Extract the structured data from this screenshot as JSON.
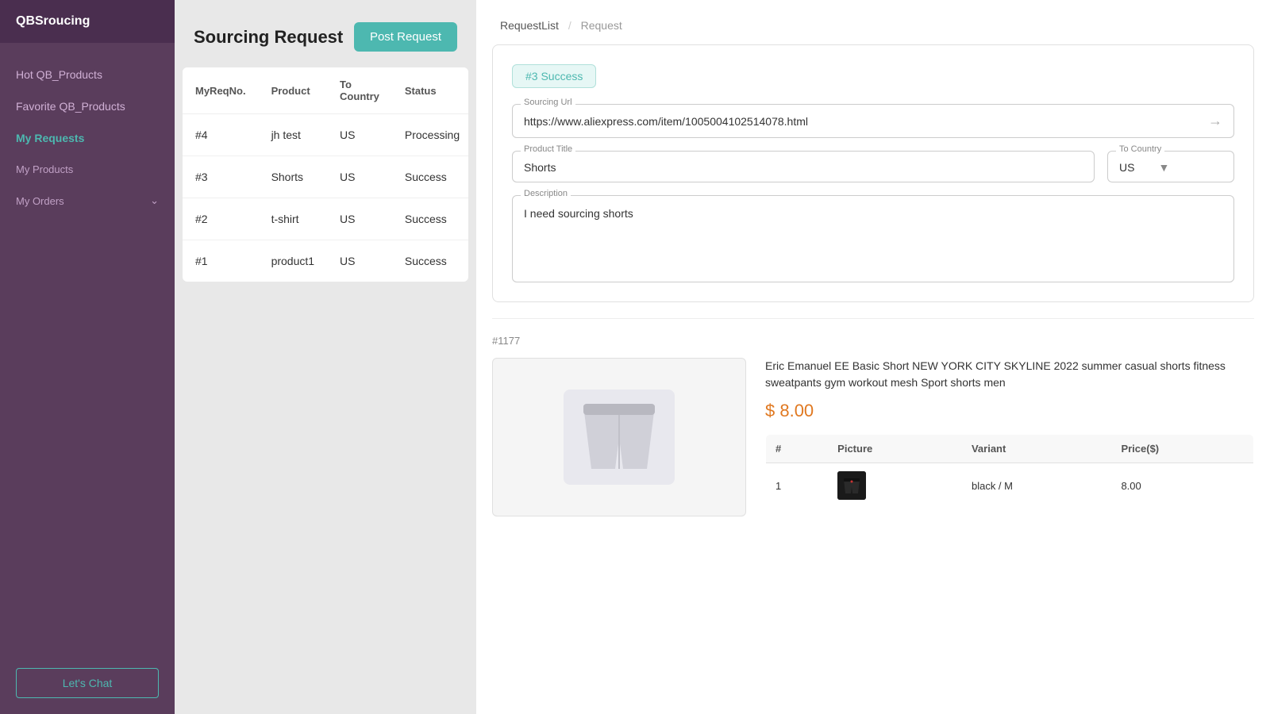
{
  "app": {
    "brand": "QBSroucing"
  },
  "sidebar": {
    "items": [
      {
        "label": "Hot QB_Products",
        "active": false,
        "sub": false
      },
      {
        "label": "Favorite QB_Products",
        "active": false,
        "sub": false
      },
      {
        "label": "My Requests",
        "active": true,
        "sub": false
      },
      {
        "label": "My Products",
        "active": false,
        "sub": false
      },
      {
        "label": "My Orders",
        "active": false,
        "sub": false,
        "arrow": true
      }
    ],
    "footer_button": "Let's Chat"
  },
  "main_left": {
    "title": "Sourcing Request",
    "post_button": "Post Request",
    "table": {
      "headers": [
        "MyReqNo.",
        "Product",
        "To Country",
        "Status"
      ],
      "rows": [
        {
          "req_no": "#4",
          "product": "jh test",
          "country": "US",
          "status": "Processing",
          "status_class": "processing"
        },
        {
          "req_no": "#3",
          "product": "Shorts",
          "country": "US",
          "status": "Success",
          "status_class": "success"
        },
        {
          "req_no": "#2",
          "product": "t-shirt",
          "country": "US",
          "status": "Success",
          "status_class": "success"
        },
        {
          "req_no": "#1",
          "product": "product1",
          "country": "US",
          "status": "Success",
          "status_class": "success"
        }
      ]
    }
  },
  "right_panel": {
    "breadcrumb": {
      "list": "RequestList",
      "separator": "/",
      "current": "Request"
    },
    "request_card": {
      "badge": "#3 Success",
      "sourcing_url_label": "Sourcing Url",
      "sourcing_url": "https://www.aliexpress.com/item/1005004102514078.html",
      "product_title_label": "Product Title",
      "product_title": "Shorts",
      "to_country_label": "To Country",
      "to_country": "US",
      "description_label": "Description",
      "description": "I need sourcing shorts"
    },
    "product_result": {
      "id": "#1177",
      "name": "Eric Emanuel EE Basic Short NEW YORK CITY SKYLINE 2022 summer casual shorts fitness sweatpants gym workout mesh Sport shorts men",
      "price": "$ 8.00",
      "variants_headers": [
        "#",
        "Picture",
        "Variant",
        "Price($)"
      ],
      "variants": [
        {
          "num": "1",
          "variant": "black / M",
          "price": "8.00"
        }
      ]
    }
  }
}
